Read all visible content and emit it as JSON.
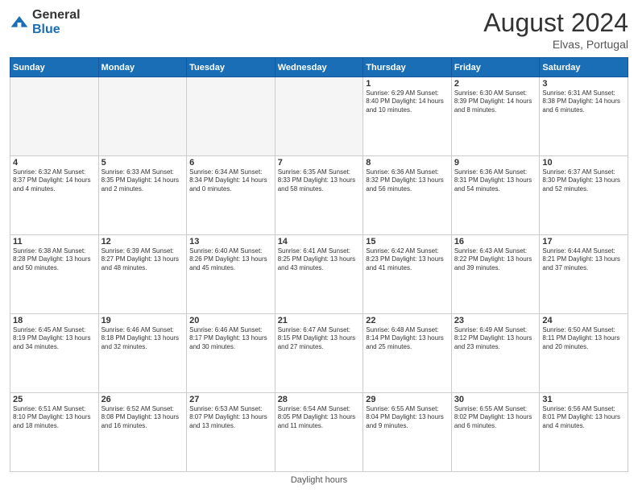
{
  "header": {
    "logo_general": "General",
    "logo_blue": "Blue",
    "month_title": "August 2024",
    "location": "Elvas, Portugal"
  },
  "footer": {
    "daylight_label": "Daylight hours"
  },
  "days_of_week": [
    "Sunday",
    "Monday",
    "Tuesday",
    "Wednesday",
    "Thursday",
    "Friday",
    "Saturday"
  ],
  "weeks": [
    [
      {
        "day": "",
        "info": ""
      },
      {
        "day": "",
        "info": ""
      },
      {
        "day": "",
        "info": ""
      },
      {
        "day": "",
        "info": ""
      },
      {
        "day": "1",
        "info": "Sunrise: 6:29 AM\nSunset: 8:40 PM\nDaylight: 14 hours\nand 10 minutes."
      },
      {
        "day": "2",
        "info": "Sunrise: 6:30 AM\nSunset: 8:39 PM\nDaylight: 14 hours\nand 8 minutes."
      },
      {
        "day": "3",
        "info": "Sunrise: 6:31 AM\nSunset: 8:38 PM\nDaylight: 14 hours\nand 6 minutes."
      }
    ],
    [
      {
        "day": "4",
        "info": "Sunrise: 6:32 AM\nSunset: 8:37 PM\nDaylight: 14 hours\nand 4 minutes."
      },
      {
        "day": "5",
        "info": "Sunrise: 6:33 AM\nSunset: 8:35 PM\nDaylight: 14 hours\nand 2 minutes."
      },
      {
        "day": "6",
        "info": "Sunrise: 6:34 AM\nSunset: 8:34 PM\nDaylight: 14 hours\nand 0 minutes."
      },
      {
        "day": "7",
        "info": "Sunrise: 6:35 AM\nSunset: 8:33 PM\nDaylight: 13 hours\nand 58 minutes."
      },
      {
        "day": "8",
        "info": "Sunrise: 6:36 AM\nSunset: 8:32 PM\nDaylight: 13 hours\nand 56 minutes."
      },
      {
        "day": "9",
        "info": "Sunrise: 6:36 AM\nSunset: 8:31 PM\nDaylight: 13 hours\nand 54 minutes."
      },
      {
        "day": "10",
        "info": "Sunrise: 6:37 AM\nSunset: 8:30 PM\nDaylight: 13 hours\nand 52 minutes."
      }
    ],
    [
      {
        "day": "11",
        "info": "Sunrise: 6:38 AM\nSunset: 8:28 PM\nDaylight: 13 hours\nand 50 minutes."
      },
      {
        "day": "12",
        "info": "Sunrise: 6:39 AM\nSunset: 8:27 PM\nDaylight: 13 hours\nand 48 minutes."
      },
      {
        "day": "13",
        "info": "Sunrise: 6:40 AM\nSunset: 8:26 PM\nDaylight: 13 hours\nand 45 minutes."
      },
      {
        "day": "14",
        "info": "Sunrise: 6:41 AM\nSunset: 8:25 PM\nDaylight: 13 hours\nand 43 minutes."
      },
      {
        "day": "15",
        "info": "Sunrise: 6:42 AM\nSunset: 8:23 PM\nDaylight: 13 hours\nand 41 minutes."
      },
      {
        "day": "16",
        "info": "Sunrise: 6:43 AM\nSunset: 8:22 PM\nDaylight: 13 hours\nand 39 minutes."
      },
      {
        "day": "17",
        "info": "Sunrise: 6:44 AM\nSunset: 8:21 PM\nDaylight: 13 hours\nand 37 minutes."
      }
    ],
    [
      {
        "day": "18",
        "info": "Sunrise: 6:45 AM\nSunset: 8:19 PM\nDaylight: 13 hours\nand 34 minutes."
      },
      {
        "day": "19",
        "info": "Sunrise: 6:46 AM\nSunset: 8:18 PM\nDaylight: 13 hours\nand 32 minutes."
      },
      {
        "day": "20",
        "info": "Sunrise: 6:46 AM\nSunset: 8:17 PM\nDaylight: 13 hours\nand 30 minutes."
      },
      {
        "day": "21",
        "info": "Sunrise: 6:47 AM\nSunset: 8:15 PM\nDaylight: 13 hours\nand 27 minutes."
      },
      {
        "day": "22",
        "info": "Sunrise: 6:48 AM\nSunset: 8:14 PM\nDaylight: 13 hours\nand 25 minutes."
      },
      {
        "day": "23",
        "info": "Sunrise: 6:49 AM\nSunset: 8:12 PM\nDaylight: 13 hours\nand 23 minutes."
      },
      {
        "day": "24",
        "info": "Sunrise: 6:50 AM\nSunset: 8:11 PM\nDaylight: 13 hours\nand 20 minutes."
      }
    ],
    [
      {
        "day": "25",
        "info": "Sunrise: 6:51 AM\nSunset: 8:10 PM\nDaylight: 13 hours\nand 18 minutes."
      },
      {
        "day": "26",
        "info": "Sunrise: 6:52 AM\nSunset: 8:08 PM\nDaylight: 13 hours\nand 16 minutes."
      },
      {
        "day": "27",
        "info": "Sunrise: 6:53 AM\nSunset: 8:07 PM\nDaylight: 13 hours\nand 13 minutes."
      },
      {
        "day": "28",
        "info": "Sunrise: 6:54 AM\nSunset: 8:05 PM\nDaylight: 13 hours\nand 11 minutes."
      },
      {
        "day": "29",
        "info": "Sunrise: 6:55 AM\nSunset: 8:04 PM\nDaylight: 13 hours\nand 9 minutes."
      },
      {
        "day": "30",
        "info": "Sunrise: 6:55 AM\nSunset: 8:02 PM\nDaylight: 13 hours\nand 6 minutes."
      },
      {
        "day": "31",
        "info": "Sunrise: 6:56 AM\nSunset: 8:01 PM\nDaylight: 13 hours\nand 4 minutes."
      }
    ]
  ]
}
